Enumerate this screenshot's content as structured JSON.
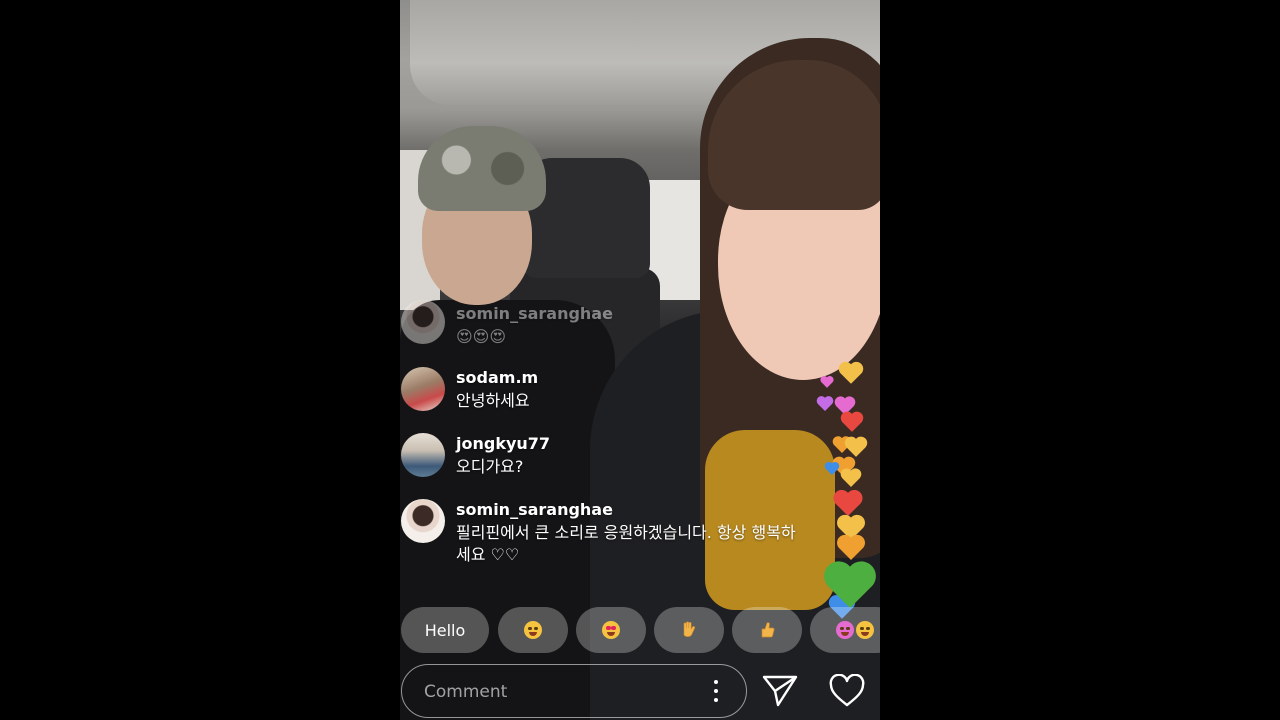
{
  "live": {
    "comments": [
      {
        "username": "somin_saranghae",
        "text": "😍😍😍",
        "faded": true
      },
      {
        "username": "sodam.m",
        "text": "안녕하세요"
      },
      {
        "username": "jongkyu77",
        "text": "오디가요?"
      },
      {
        "username": "somin_saranghae",
        "text": "필리핀에서 큰 소리로 응원하겠습니다.  항상 행복하세요 ♡♡"
      }
    ],
    "quick_reactions": {
      "hello_label": "Hello",
      "items": [
        "laughing-emoji",
        "heart-eyes-emoji",
        "waving-hand-emoji",
        "thumbs-up-emoji",
        "emoji-more"
      ]
    },
    "comment_input": {
      "placeholder": "Comment"
    },
    "icons": {
      "options": "more-vertical-icon",
      "send": "send-icon",
      "like": "heart-icon"
    },
    "colors": {
      "heart_red": "#e8483f",
      "heart_orange": "#f0a030",
      "heart_yellow": "#f3c04a",
      "heart_green": "#4caf3f",
      "heart_blue": "#3e8ee8",
      "heart_pink": "#e66bd0"
    }
  }
}
